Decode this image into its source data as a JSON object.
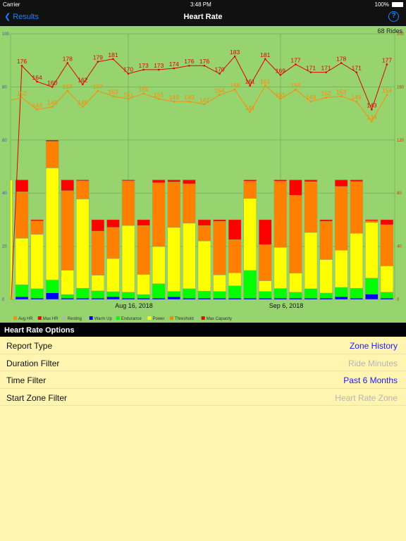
{
  "status": {
    "carrier": "Carrier",
    "time": "3:48 PM",
    "battery": "100%"
  },
  "nav": {
    "back": "Results",
    "title": "Heart Rate",
    "help": "?"
  },
  "chart_data": {
    "type": "bar+line",
    "annotation": "68 Rides",
    "x_ticks": [
      "Aug 16, 2018",
      "Sep 6, 2018"
    ],
    "left_axis": {
      "ylim": [
        0,
        100
      ],
      "ticks": [
        0,
        20,
        40,
        60,
        80,
        100
      ]
    },
    "right_axis": {
      "ylim": [
        0,
        200
      ],
      "ticks": [
        0,
        40,
        80,
        120,
        160,
        200
      ]
    },
    "grid": true,
    "legend_position": "bottom",
    "legend": [
      {
        "name": "Avg HR",
        "color": "#ff8a00"
      },
      {
        "name": "Max HR",
        "color": "#ff0000"
      },
      {
        "name": "Resting",
        "color": "#b0b0b0"
      },
      {
        "name": "Warm Up",
        "color": "#0000ff"
      },
      {
        "name": "Endurance",
        "color": "#00ff00"
      },
      {
        "name": "Power",
        "color": "#ffff00"
      },
      {
        "name": "Threshold",
        "color": "#ff8000"
      },
      {
        "name": "Max Capacity",
        "color": "#ff0000"
      }
    ],
    "stacked_bars": {
      "series": [
        {
          "name": "Warm Up",
          "values": [
            0,
            1,
            0.5,
            2.5,
            0.5,
            0.5,
            0.5,
            1,
            0.5,
            0.5,
            0.5,
            1,
            0.5,
            0.5,
            0.5,
            0.5,
            0.5,
            0.5,
            0.5,
            0.5,
            0.5,
            0.5,
            1,
            0.5,
            2,
            0.5
          ]
        },
        {
          "name": "Endurance",
          "values": [
            0,
            4.5,
            3.5,
            4.8,
            1.3,
            3.7,
            2.7,
            1.9,
            2.2,
            1.3,
            5.4,
            2,
            3.5,
            2.6,
            2.5,
            4.6,
            10.4,
            2.5,
            3.6,
            2.2,
            3.5,
            1.9,
            3.5,
            3.7,
            6,
            2.2
          ]
        },
        {
          "name": "Power",
          "values": [
            45,
            17.5,
            20.5,
            42.2,
            9.2,
            33.6,
            5.9,
            12.5,
            25.1,
            7.6,
            14,
            24.1,
            24.7,
            18.9,
            6.2,
            4.9,
            27.1,
            4,
            15.5,
            7.2,
            21.2,
            12.6,
            14,
            20.7,
            21,
            9.9
          ]
        },
        {
          "name": "Threshold",
          "values": [
            0,
            17.5,
            5,
            10,
            29.9,
            6.8,
            16.6,
            11.7,
            16.8,
            18.4,
            24,
            17.1,
            14.8,
            5.8,
            20.2,
            12.5,
            6.5,
            13.6,
            24.9,
            29.3,
            19.1,
            14.4,
            24,
            19.5,
            0.6,
            15.5
          ]
        },
        {
          "name": "Max Capacity",
          "values": [
            0,
            4.5,
            0.5,
            0.5,
            4.1,
            0.4,
            4.3,
            2.9,
            0.4,
            2.2,
            1.1,
            0.8,
            1.5,
            2.2,
            0.6,
            7.5,
            0.5,
            9.4,
            0.5,
            5.8,
            0.7,
            0.6,
            2.5,
            0.6,
            0.4,
            1.9
          ]
        }
      ]
    },
    "lines": [
      {
        "name": "Max HR",
        "values": [
          0,
          176,
          164,
          160,
          178,
          162,
          179,
          181,
          170,
          173,
          173,
          174,
          176,
          176,
          170,
          183,
          161,
          181,
          169,
          177,
          171,
          171,
          178,
          171,
          143,
          177
        ]
      },
      {
        "name": "Avg HR",
        "values": [
          150,
          152,
          143,
          145,
          157,
          145,
          157,
          153,
          151,
          155,
          151,
          149,
          149,
          147,
          154,
          158,
          141,
          161,
          151,
          158,
          149,
          152,
          153,
          149,
          134,
          154
        ]
      }
    ]
  },
  "options": {
    "header": "Heart Rate Options",
    "rows": [
      {
        "label": "Report Type",
        "value": "Zone History",
        "color": "#1a1aff"
      },
      {
        "label": "Duration Filter",
        "value": "Ride Minutes",
        "color": "#b5b5b5"
      },
      {
        "label": "Time Filter",
        "value": "Past 6 Months",
        "color": "#1a1aff"
      },
      {
        "label": "Start Zone Filter",
        "value": "Heart Rate Zone",
        "color": "#b5b5b5"
      }
    ]
  }
}
